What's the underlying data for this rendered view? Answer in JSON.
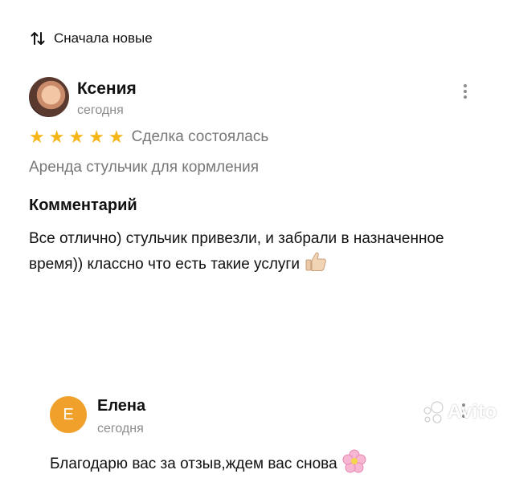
{
  "sort": {
    "label": "Сначала новые",
    "icon": "sort-arrows-icon"
  },
  "review": {
    "author": "Ксения",
    "date": "сегодня",
    "rating": 5,
    "rating_max": 5,
    "status": "Сделка состоялась",
    "item": "Аренда стульчик для кормления",
    "comment_heading": "Комментарий",
    "comment_text": "Все отлично) стульчик привезли, и забрали в назначенное время)) классно что есть такие услуги"
  },
  "reply": {
    "avatar_letter": "Е",
    "author": "Елена",
    "date": "сегодня",
    "text": "Благодарю вас за отзыв,ждем вас снова"
  },
  "watermark": {
    "text": "Avito"
  },
  "colors": {
    "star": "#f5b619",
    "avatar_bg": "#f0a12c",
    "muted": "#8c8c8c"
  }
}
